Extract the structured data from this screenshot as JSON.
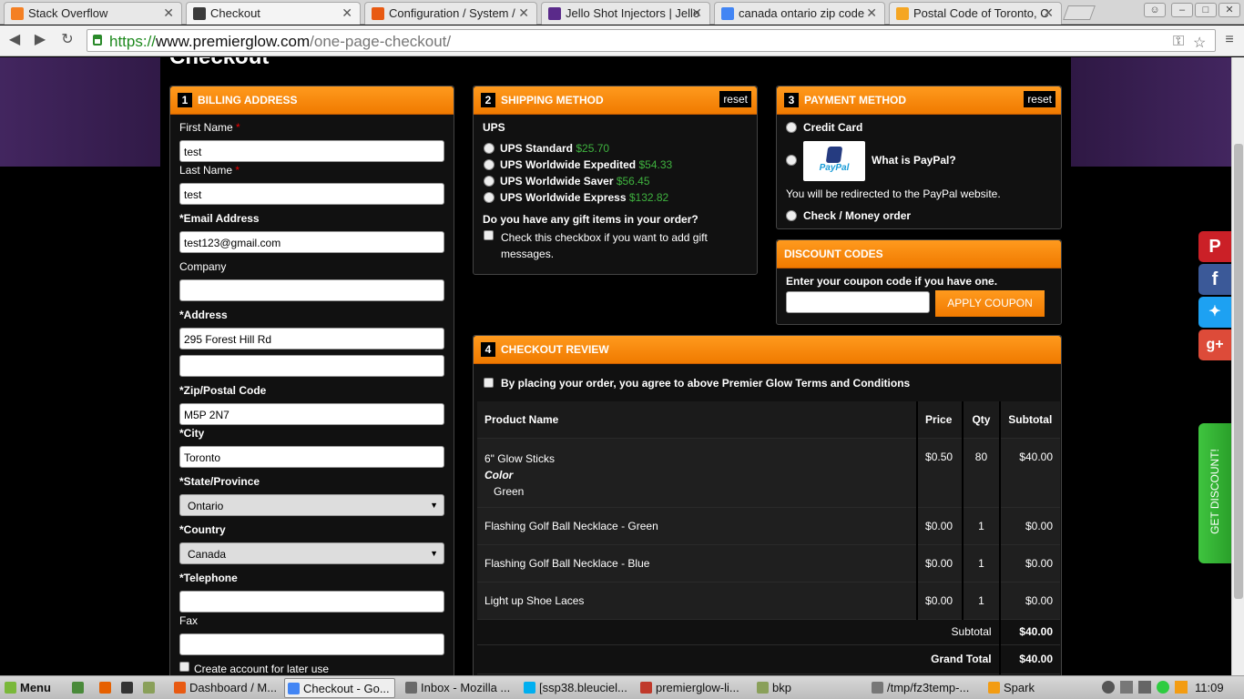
{
  "browser": {
    "tabs": [
      {
        "title": "Stack Overflow",
        "color": "#f48024"
      },
      {
        "title": "Checkout",
        "color": "#3a3a3a"
      },
      {
        "title": "Configuration / System /",
        "color": "#e85a12"
      },
      {
        "title": "Jello Shot Injectors | Jello",
        "color": "#5a2a8a"
      },
      {
        "title": "canada ontario zip code",
        "color": "#4285f4"
      },
      {
        "title": "Postal Code of Toronto, C",
        "color": "#f5a623"
      }
    ],
    "url_scheme": "https://",
    "url_domain": "www.premierglow.com",
    "url_path": "/one-page-checkout/"
  },
  "page": {
    "title": "Checkout"
  },
  "billing": {
    "num": "1",
    "title": "BILLING ADDRESS",
    "first_name_label": "First Name",
    "first_name": "test",
    "last_name_label": "Last Name",
    "last_name": "test",
    "email_label": "*Email Address",
    "email": "test123@gmail.com",
    "company_label": "Company",
    "company": "",
    "address_label": "*Address",
    "address1": "295 Forest Hill Rd",
    "address2": "",
    "zip_label": "*Zip/Postal Code",
    "zip": "M5P 2N7",
    "city_label": "*City",
    "city": "Toronto",
    "state_label": "*State/Province",
    "state": "Ontario",
    "country_label": "*Country",
    "country": "Canada",
    "telephone_label": "*Telephone",
    "telephone": "",
    "fax_label": "Fax",
    "fax": "",
    "create_account_label": "Create account for later use"
  },
  "shipping": {
    "num": "2",
    "title": "SHIPPING METHOD",
    "reset": "reset",
    "carrier": "UPS",
    "options": [
      {
        "name": "UPS Standard",
        "price": "$25.70"
      },
      {
        "name": "UPS Worldwide Expedited",
        "price": "$54.33"
      },
      {
        "name": "UPS Worldwide Saver",
        "price": "$56.45"
      },
      {
        "name": "UPS Worldwide Express",
        "price": "$132.82"
      }
    ],
    "gift_question": "Do you have any gift items in your order?",
    "gift_label": "Check this checkbox if you want to add gift messages."
  },
  "payment": {
    "num": "3",
    "title": "PAYMENT METHOD",
    "reset": "reset",
    "credit_card": "Credit Card",
    "paypal_logo": "PayPal",
    "what_is_paypal": "What is PayPal?",
    "redirect_note": "You will be redirected to the PayPal website.",
    "check_money": "Check / Money order"
  },
  "discount": {
    "title": "DISCOUNT CODES",
    "prompt": "Enter your coupon code if you have one.",
    "code": "",
    "apply": "APPLY COUPON"
  },
  "review": {
    "num": "4",
    "title": "CHECKOUT REVIEW",
    "terms": "By placing your order, you agree to above Premier Glow Terms and Conditions",
    "headers": {
      "product": "Product Name",
      "price": "Price",
      "qty": "Qty",
      "subtotal": "Subtotal"
    },
    "items": [
      {
        "name": "6\" Glow Sticks",
        "option_label": "Color",
        "option_value": "Green",
        "price": "$0.50",
        "qty": "80",
        "subtotal": "$40.00"
      },
      {
        "name": "Flashing Golf Ball Necklace - Green",
        "price": "$0.00",
        "qty": "1",
        "subtotal": "$0.00"
      },
      {
        "name": "Flashing Golf Ball Necklace - Blue",
        "price": "$0.00",
        "qty": "1",
        "subtotal": "$0.00"
      },
      {
        "name": "Light up Shoe Laces",
        "price": "$0.00",
        "qty": "1",
        "subtotal": "$0.00"
      }
    ],
    "subtotal_label": "Subtotal",
    "subtotal": "$40.00",
    "grand_total_label": "Grand Total",
    "grand_total": "$40.00"
  },
  "social": {
    "pinterest_color": "#cb2027",
    "facebook_color": "#3b5998",
    "twitter_color": "#1da1f2",
    "gplus_color": "#dd4b39",
    "get_discount": "GET DISCOUNT!"
  },
  "taskbar": {
    "menu": "Menu",
    "tasks": [
      {
        "title": "Dashboard / M...",
        "color": "#e85a12"
      },
      {
        "title": "Checkout - Go...",
        "color": "#4285f4"
      },
      {
        "title": "Inbox - Mozilla ...",
        "color": "#6a6a6a"
      },
      {
        "title": "[ssp38.bleuciel...",
        "color": "#00aff0"
      },
      {
        "title": "premierglow-li...",
        "color": "#c0392b"
      },
      {
        "title": "bkp",
        "color": "#8aa05a"
      },
      {
        "title": "/tmp/fz3temp-...",
        "color": "#777"
      },
      {
        "title": "Spark",
        "color": "#f39c12"
      }
    ],
    "clock": "11:09"
  }
}
